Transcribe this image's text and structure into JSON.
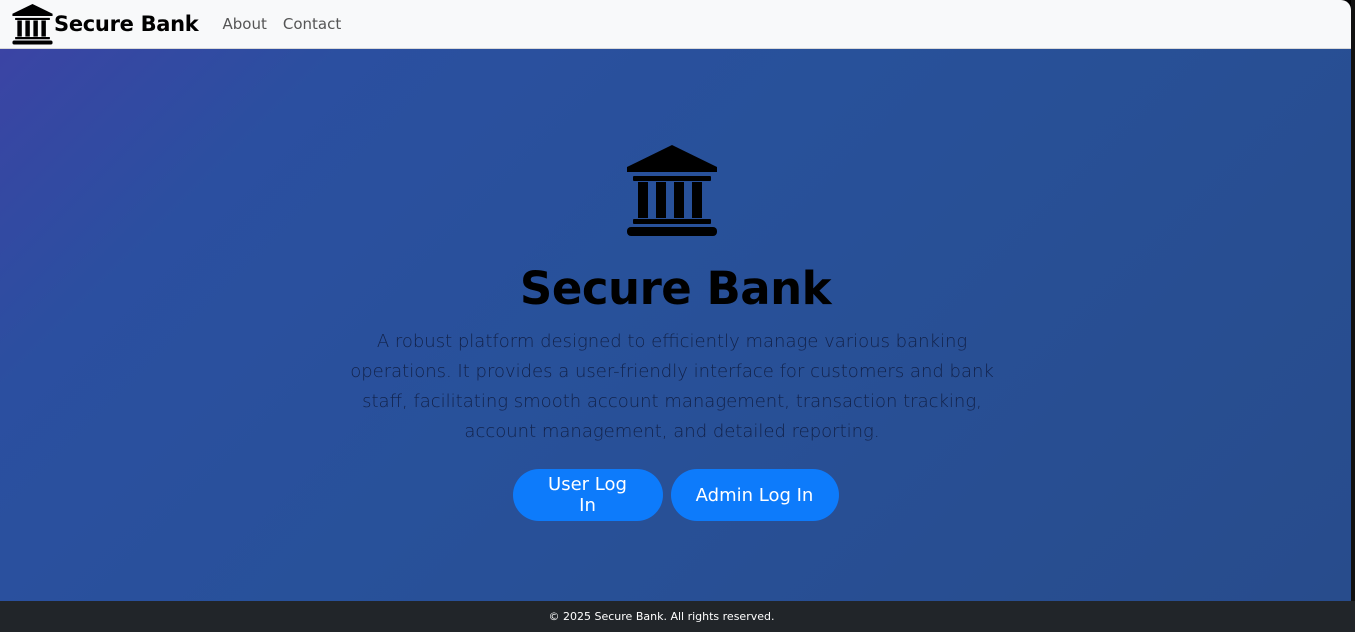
{
  "navbar": {
    "brand_icon": "bank-icon",
    "brand_text": "Secure Bank",
    "links": [
      {
        "label": "About"
      },
      {
        "label": "Contact"
      }
    ]
  },
  "hero": {
    "icon": "bank-icon",
    "title": "Secure Bank",
    "description": "A robust platform designed to efficiently manage various banking operations. It provides a user-friendly interface for customers and bank staff, facilitating smooth account management, transaction tracking, account management, and detailed reporting.",
    "buttons": {
      "user_login": "User Log In",
      "admin_login": "Admin Log In"
    }
  },
  "footer": {
    "text": "© 2025 Secure Bank. All rights reserved."
  },
  "colors": {
    "navbar_bg": "#f8f9fa",
    "hero_gradient_start": "#3b44a4",
    "hero_gradient_end": "#284c8c",
    "button_primary": "#0d7bfb",
    "footer_bg": "#212529"
  }
}
